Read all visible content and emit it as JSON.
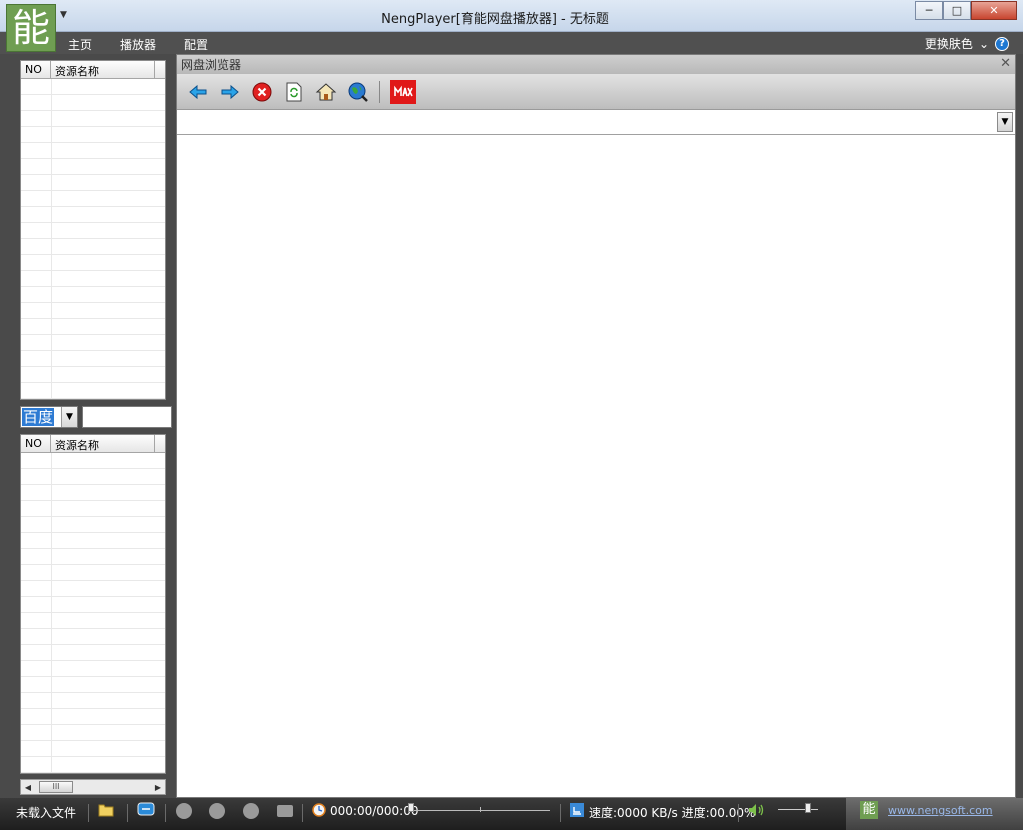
{
  "window": {
    "logo_char": "能",
    "title": "NengPlayer[育能网盘播放器] - 无标题",
    "minimize": "─",
    "maximize": "□",
    "close": "✕"
  },
  "menu": {
    "items": [
      "主页",
      "播放器",
      "配置"
    ],
    "skin_label": "更换肤色",
    "skin_arrow": "⌄",
    "help": "?"
  },
  "list_top": {
    "col_no": "NO",
    "col_name": "资源名称"
  },
  "search": {
    "engine": "百度",
    "arrow": "▼",
    "query": ""
  },
  "list_bottom": {
    "col_no": "NO",
    "col_name": "资源名称"
  },
  "scroll": {
    "left": "◀",
    "right": "▶",
    "thumb": "III"
  },
  "browser": {
    "title": "网盘浏览器",
    "close": "✕",
    "address": "",
    "toolbar": [
      "back-arrow-icon",
      "forward-arrow-icon",
      "stop-icon",
      "refresh-icon",
      "home-icon",
      "globe-search-icon",
      "max-icon"
    ]
  },
  "status": {
    "file_label": "未载入文件",
    "time": "000:00/000:00",
    "speed_label": "速度:0000 KB/s 进度:00.00%",
    "brand_char": "能",
    "brand_url": "www.nengsoft.com"
  },
  "colors": {
    "accent": "#6f9e52",
    "highlight": "#2e7bd3",
    "menubar": "#505050"
  }
}
